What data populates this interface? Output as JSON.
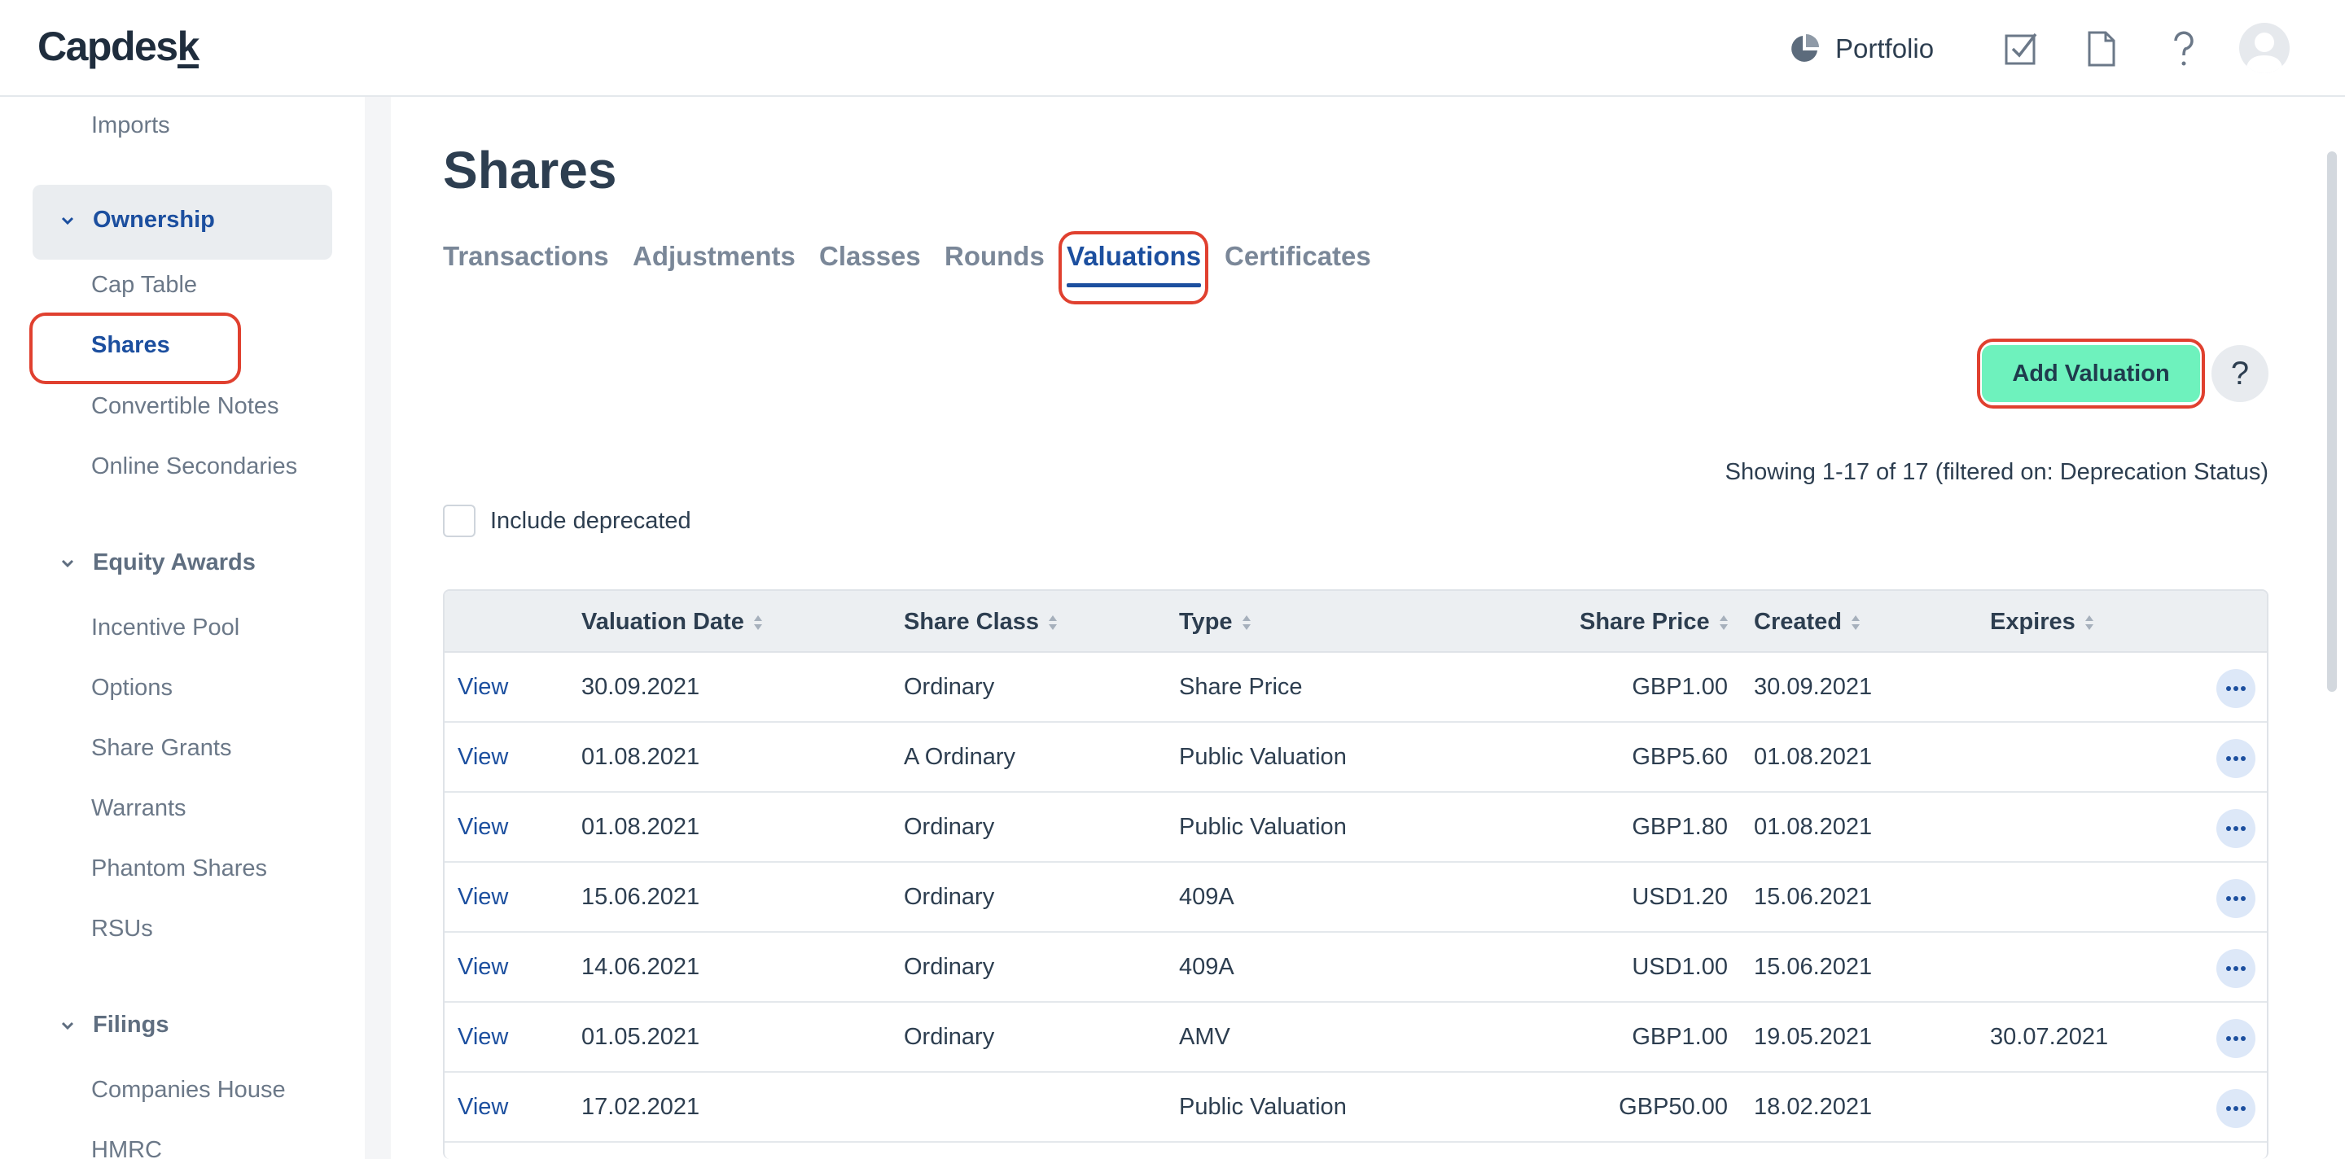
{
  "app": {
    "logo": "Capdes",
    "logo_underlined": "k"
  },
  "topnav": {
    "portfolio_label": "Portfolio"
  },
  "sidebar": {
    "imports": "Imports",
    "ownership": {
      "label": "Ownership",
      "items": [
        "Cap Table",
        "Shares",
        "Convertible Notes",
        "Online Secondaries"
      ]
    },
    "equity_awards": {
      "label": "Equity Awards",
      "items": [
        "Incentive Pool",
        "Options",
        "Share Grants",
        "Warrants",
        "Phantom Shares",
        "RSUs"
      ]
    },
    "filings": {
      "label": "Filings",
      "items": [
        "Companies House",
        "HMRC"
      ]
    }
  },
  "page": {
    "title": "Shares",
    "tabs": [
      "Transactions",
      "Adjustments",
      "Classes",
      "Rounds",
      "Valuations",
      "Certificates"
    ],
    "active_tab": "Valuations",
    "add_button": "Add Valuation",
    "help_button": "?",
    "showing": "Showing 1-17 of 17 (filtered on: Deprecation Status)",
    "include_deprecated": "Include deprecated"
  },
  "table": {
    "columns": [
      "Valuation Date",
      "Share Class",
      "Type",
      "Share Price",
      "Created",
      "Expires"
    ],
    "rows": [
      {
        "action": "View",
        "date": "30.09.2021",
        "class": "Ordinary",
        "type": "Share Price",
        "price": "GBP1.00",
        "created": "30.09.2021",
        "expires": ""
      },
      {
        "action": "View",
        "date": "01.08.2021",
        "class": "A Ordinary",
        "type": "Public Valuation",
        "price": "GBP5.60",
        "created": "01.08.2021",
        "expires": ""
      },
      {
        "action": "View",
        "date": "01.08.2021",
        "class": "Ordinary",
        "type": "Public Valuation",
        "price": "GBP1.80",
        "created": "01.08.2021",
        "expires": ""
      },
      {
        "action": "View",
        "date": "15.06.2021",
        "class": "Ordinary",
        "type": "409A",
        "price": "USD1.20",
        "created": "15.06.2021",
        "expires": ""
      },
      {
        "action": "View",
        "date": "14.06.2021",
        "class": "Ordinary",
        "type": "409A",
        "price": "USD1.00",
        "created": "15.06.2021",
        "expires": ""
      },
      {
        "action": "View",
        "date": "01.05.2021",
        "class": "Ordinary",
        "type": "AMV",
        "price": "GBP1.00",
        "created": "19.05.2021",
        "expires": "30.07.2021"
      },
      {
        "action": "View",
        "date": "17.02.2021",
        "class": "",
        "type": "Public Valuation",
        "price": "GBP50.00",
        "created": "18.02.2021",
        "expires": ""
      }
    ]
  },
  "colors": {
    "accent": "#1c4f9f",
    "primary_button": "#6ef2bd",
    "highlight": "#e0402f"
  }
}
